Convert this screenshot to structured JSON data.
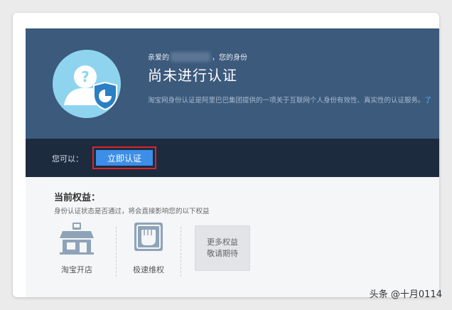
{
  "banner": {
    "greeting_prefix": "亲爱的",
    "greeting_suffix": "，您的身份",
    "status_title": "尚未进行认证",
    "description": "淘宝网身份认证是阿里巴巴集团提供的一项关于互联网个人身份有效性、真实性的认证服务。",
    "description_more": "了",
    "colors": {
      "banner_bg": "#3c5a7c",
      "avatar_bg": "#8fd4ef"
    }
  },
  "action_bar": {
    "prompt_label": "您可以：",
    "verify_button_label": "立即认证",
    "colors": {
      "bar_bg": "#1d2b3f",
      "button_bg": "#3d8ee6",
      "highlight": "#d4282c"
    }
  },
  "rights": {
    "title": "当前权益：",
    "note": "身份认证状态是否通过，将会直接影响您的以下权益",
    "items": [
      {
        "label": "淘宝开店",
        "icon": "shop-icon"
      },
      {
        "label": "极速维权",
        "icon": "fist-icon"
      }
    ],
    "more_line1": "更多权益",
    "more_line2": "敬请期待"
  },
  "watermark": "头条 @十月0114"
}
